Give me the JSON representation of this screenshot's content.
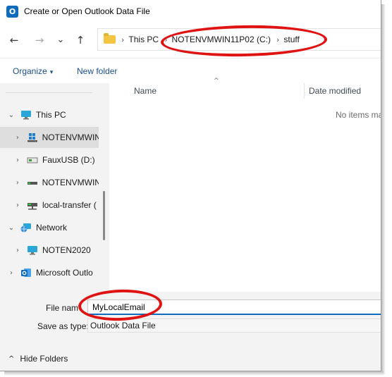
{
  "window": {
    "title": "Create or Open Outlook Data File",
    "app_icon": "outlook-icon",
    "app_icon_glyph": "O"
  },
  "nav": {
    "back": "←",
    "forward": "→",
    "recent": "⌄",
    "up": "↑",
    "breadcrumb": [
      "This PC",
      "NOTENVMWIN11P02 (C:)",
      "stuff"
    ],
    "separator": "›"
  },
  "commands": {
    "organize": "Organize",
    "organize_caret": "▾",
    "new_folder": "New folder"
  },
  "sidebar": {
    "items": [
      {
        "label": "This PC",
        "icon": "monitor-icon",
        "chevron": "⌄"
      },
      {
        "label": "NOTENVMWIN",
        "icon": "windows-drive-icon",
        "chevron": "›"
      },
      {
        "label": "FauxUSB (D:)",
        "icon": "usb-drive-icon",
        "chevron": "›"
      },
      {
        "label": "NOTENVMWIN",
        "icon": "drive-icon",
        "chevron": "›"
      },
      {
        "label": "local-transfer (",
        "icon": "network-drive-icon",
        "chevron": "›"
      },
      {
        "label": "Network",
        "icon": "network-icon",
        "chevron": "⌄"
      },
      {
        "label": "NOTEN2020",
        "icon": "monitor-icon",
        "chevron": "›"
      },
      {
        "label": "Microsoft Outlo",
        "icon": "outlook-icon",
        "chevron": "›"
      }
    ]
  },
  "file_list": {
    "columns": [
      "Name",
      "Date modified"
    ],
    "sort_indicator": "^",
    "empty_message": "No items ma"
  },
  "form": {
    "file_name_label": "File nam",
    "file_name_value": "MyLocalEmail",
    "save_type_label": "Save as type:",
    "save_type_value": "Outlook Data File"
  },
  "footer": {
    "hide_folders": "Hide Folders",
    "hide_caret": "^"
  },
  "colors": {
    "accent": "#0f6cbd",
    "annotation": "#e01313",
    "link": "#1b4f8a"
  }
}
